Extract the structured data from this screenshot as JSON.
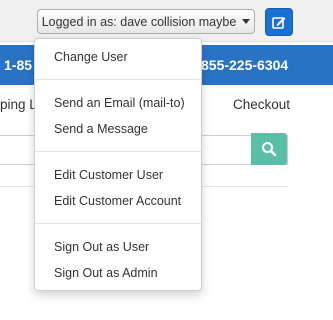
{
  "topbar": {
    "user_menu_label": "Logged in as: dave collision maybe"
  },
  "bluebar": {
    "left_text": "1-85",
    "right_text": "855-225-6304"
  },
  "nav": {
    "left_text": "ping L",
    "paren_text": ")",
    "checkout_label": "Checkout"
  },
  "dropdown": {
    "items": [
      {
        "label": "Change User"
      },
      {
        "label": "Send an Email (mail-to)"
      },
      {
        "label": "Send a Message"
      },
      {
        "label": "Edit Customer User"
      },
      {
        "label": "Edit Customer Account"
      },
      {
        "label": "Sign Out as User"
      },
      {
        "label": "Sign Out as Admin"
      }
    ]
  },
  "colors": {
    "header_blue": "#2a73c4",
    "edit_button": "#1b6fd1",
    "search_button": "#5bbfa8"
  }
}
